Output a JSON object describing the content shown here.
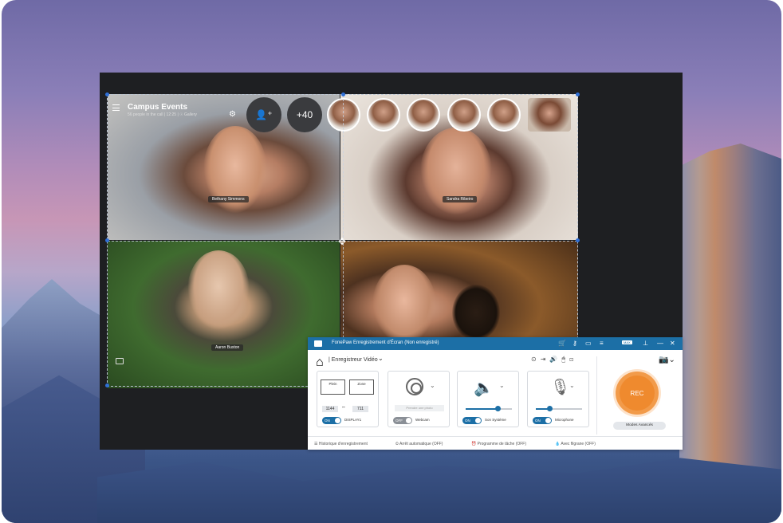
{
  "call": {
    "title": "Campus Events",
    "subtitle": "56 people in the call | 12:25 | ☉ Gallery",
    "add_people_icon": "add-person-icon",
    "more_count": "+40",
    "participants": [
      {
        "name": "Bethany Simmons"
      },
      {
        "name": "Sandra Ribeiro"
      },
      {
        "name": "Aaron Buxton"
      },
      {
        "name": ""
      }
    ]
  },
  "recorder": {
    "window_title": "FonePaw Enregistrement d'Écran (Non enregistré)",
    "mode_label": "| Enregistreur Vidéo",
    "mode_chevron": "⌄",
    "display": {
      "full_label": "Plein",
      "zone_label": "Zone",
      "width": "1144",
      "height": "711",
      "toggle": "ON",
      "label": "DISPLAY1"
    },
    "webcam": {
      "placeholder": "Prendre une photo",
      "toggle": "OFF",
      "label": "Webcam"
    },
    "system_sound": {
      "toggle": "ON",
      "label": "Son Système",
      "level": 0.7
    },
    "microphone": {
      "toggle": "ON",
      "label": "Microphone",
      "level": 0.3
    },
    "rec_label": "REC",
    "advanced_label": "Modes Avancés",
    "footer": {
      "history": "Historique d'enregistrement",
      "auto_stop": "Arrêt automatique (OFF)",
      "task_schedule": "Programme de tâche (OFF)",
      "watermark": "Avec filgrane (OFF)"
    },
    "titlebar_badge": "MAX"
  },
  "colors": {
    "titlebar": "#1c6fa6",
    "rec_orange": "#ef8a2e",
    "selection_handle": "#2f6fd6"
  }
}
